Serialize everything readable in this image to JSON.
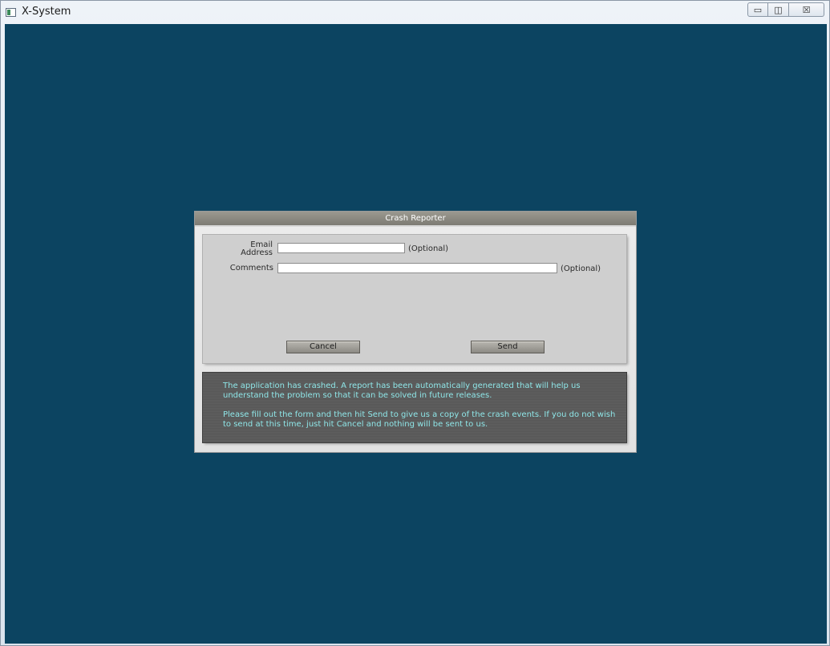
{
  "window": {
    "title": "X-System",
    "minimize_glyph": "▭",
    "maximize_glyph": "◫",
    "close_glyph": "☒"
  },
  "dialog": {
    "title": "Crash Reporter",
    "email_label_line1": "Email",
    "email_label_line2": "Address",
    "email_value": "",
    "email_optional": "(Optional)",
    "comments_label": "Comments",
    "comments_value": "",
    "comments_optional": "(Optional)",
    "cancel_label": "Cancel",
    "send_label": "Send",
    "message_paragraph_1": "The application has crashed. A report has been automatically generated that will help us understand the problem so that it can be solved in future releases.",
    "message_paragraph_2": "Please fill out the form and then hit Send to give us a copy of the crash events. If you do not wish to send at this time, just hit Cancel and nothing will be sent to us."
  },
  "colors": {
    "desktop_background": "#0c4461",
    "message_text": "#8fe6e8",
    "message_background": "#5b5b5b"
  }
}
